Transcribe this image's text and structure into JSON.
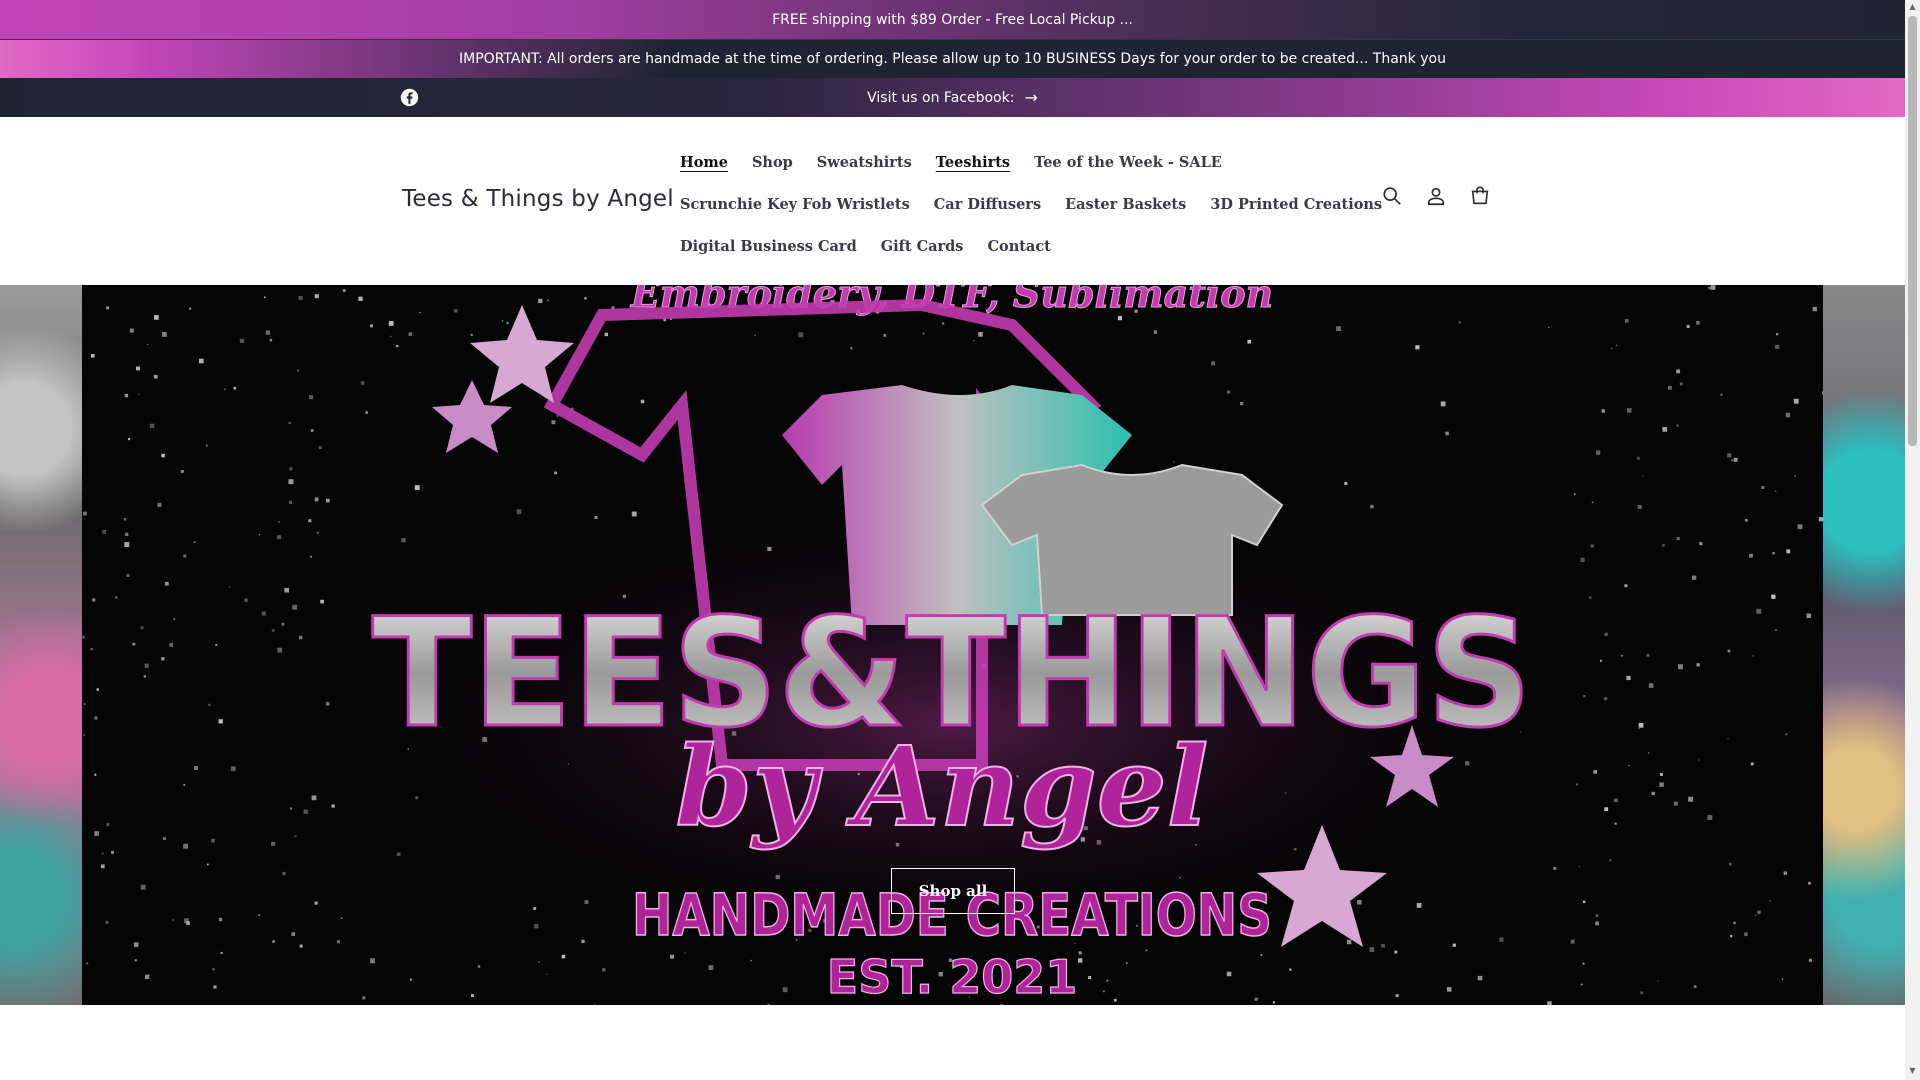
{
  "announcements": [
    "FREE shipping with $89 Order - Free Local Pickup ...",
    "IMPORTANT: All orders are handmade at the time of ordering. Please allow up to 10 BUSINESS Days for your order to be created... Thank you",
    "Visit us on Facebook:"
  ],
  "social": {
    "icon": "facebook-icon"
  },
  "header": {
    "brand": "Tees & Things by Angel",
    "nav_rows": [
      [
        "Home",
        "Shop",
        "Sweatshirts",
        "Teeshirts",
        "Tee of the Week - SALE"
      ],
      [
        "Scrunchie Key Fob Wristlets",
        "Car Diffusers",
        "Easter Baskets",
        "3D Printed Creations"
      ],
      [
        "Digital Business Card",
        "Gift Cards",
        "Contact"
      ]
    ],
    "icons": [
      "search-icon",
      "account-icon",
      "cart-icon"
    ]
  },
  "hero": {
    "banner_top": "Embroidery, DTF, Sublimation",
    "banner_title": "TEES&THINGS",
    "banner_script": "by Angel",
    "banner_sub": "HANDMADE CREATIONS",
    "banner_est": "EST. 2021",
    "button_label": "Shop all"
  },
  "colors": {
    "announcement_bg": "#1f2433",
    "accent_pink": "#c244b8",
    "hero_bg": "#050505"
  }
}
